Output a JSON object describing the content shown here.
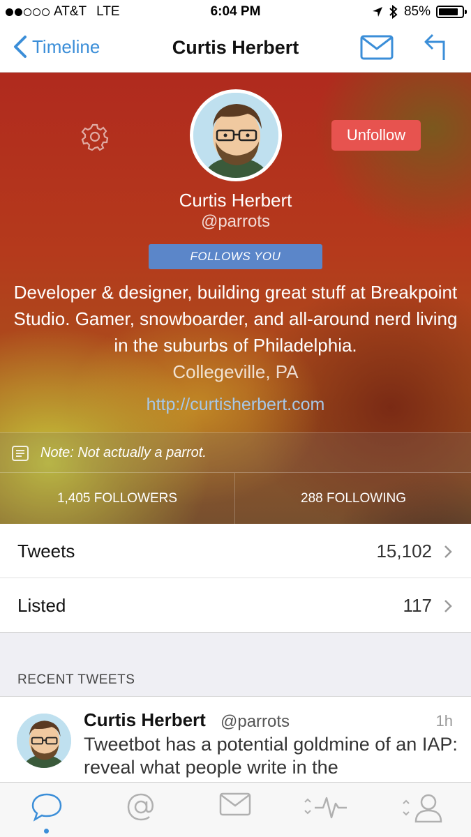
{
  "status_bar": {
    "carrier": "AT&T",
    "network": "LTE",
    "time": "6:04 PM",
    "battery": "85%",
    "battery_level": 0.85
  },
  "nav": {
    "back_label": "Timeline",
    "title": "Curtis Herbert"
  },
  "profile": {
    "action_button": "Unfollow",
    "name": "Curtis Herbert",
    "handle": "@parrots",
    "follows_badge": "FOLLOWS YOU",
    "bio": "Developer & designer, building great stuff at Breakpoint Studio. Gamer, snowboarder, and all-around nerd living in the suburbs of Philadelphia.",
    "location": "Collegeville, PA",
    "website": "http://curtisherbert.com",
    "note": "Note: Not actually a parrot.",
    "followers": "1,405 FOLLOWERS",
    "following": "288 FOLLOWING"
  },
  "stats": [
    {
      "label": "Tweets",
      "value": "15,102"
    },
    {
      "label": "Listed",
      "value": "117"
    }
  ],
  "recent_header": "RECENT TWEETS",
  "tweet": {
    "name": "Curtis Herbert",
    "handle": "@parrots",
    "time": "1h",
    "text": "Tweetbot has a potential goldmine of an IAP: reveal what people write in the"
  },
  "tab_bar": {
    "tabs": [
      "timeline-icon",
      "mentions-icon",
      "messages-icon",
      "activity-icon",
      "profile-icon"
    ],
    "active": 0
  },
  "colors": {
    "accent": "#3b8ed8",
    "unfollow": "#e7534f",
    "follows_badge": "#5b86c9"
  }
}
